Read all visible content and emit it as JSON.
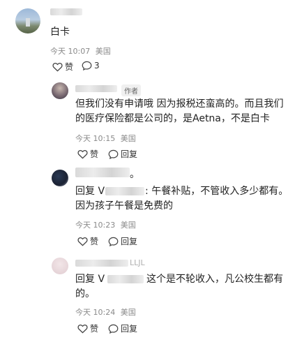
{
  "comments": [
    {
      "text": "白卡",
      "time": "今天 10:07",
      "location": "美国",
      "like_label": "赞",
      "reply_count": "3"
    }
  ],
  "replies": [
    {
      "author_badge": "作者",
      "text_line1": "但我们没有申请哦 因为报税还蛮高的。而且我们",
      "text_line2": "的医疗保险都是公司的，是Aetna，不是白卡",
      "time": "今天 10:15",
      "location": "美国",
      "like_label": "赞",
      "reply_label": "回复"
    },
    {
      "name_suffix": "。",
      "prefix": "回复 V",
      "text_line1_rest": ": 午餐补贴，不管收入多少都有。",
      "text_line2": "因为孩子午餐是免费的",
      "time": "今天 10:23",
      "location": "美国",
      "like_label": "赞",
      "reply_label": "回复"
    },
    {
      "name_tail": "LLJL",
      "prefix": "回复 V",
      "text_line1_rest": "这个是不轮收入，凡公校生都有",
      "text_line2": "的。",
      "time": "今天 10:24",
      "location": "美国",
      "like_label": "赞",
      "reply_label": "回复"
    }
  ]
}
